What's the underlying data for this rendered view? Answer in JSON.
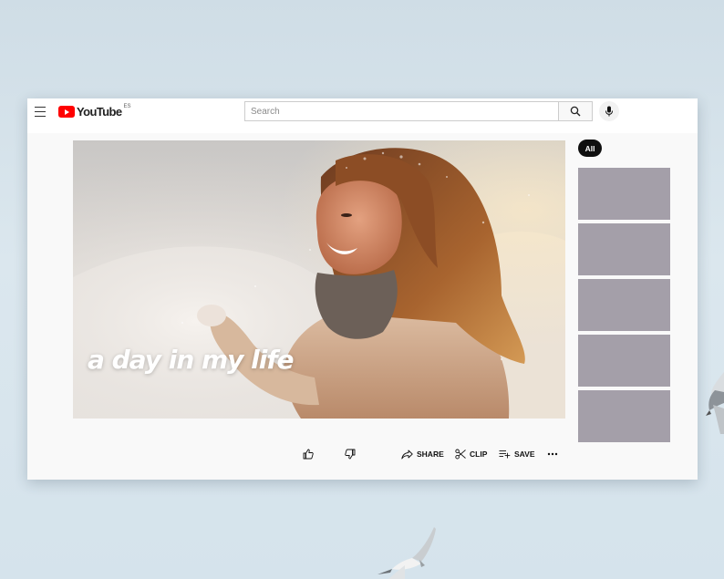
{
  "header": {
    "logo_text": "YouTube",
    "region": "ES",
    "search_placeholder": "Search"
  },
  "video": {
    "overlay_title": "a day in my life"
  },
  "actions": {
    "share": "SHARE",
    "clip": "CLIP",
    "save": "SAVE"
  },
  "sidebar": {
    "chip_all": "All",
    "thumbnail_count": 5
  },
  "colors": {
    "brand_red": "#ff0000",
    "thumbnail_placeholder": "#a49fa9",
    "chip_background": "#0f0f0f"
  },
  "icons": [
    "menu-icon",
    "youtube-logo-icon",
    "search-icon",
    "mic-icon",
    "thumbs-up-icon",
    "thumbs-down-icon",
    "share-icon",
    "scissors-icon",
    "save-playlist-icon",
    "more-dots-icon"
  ]
}
